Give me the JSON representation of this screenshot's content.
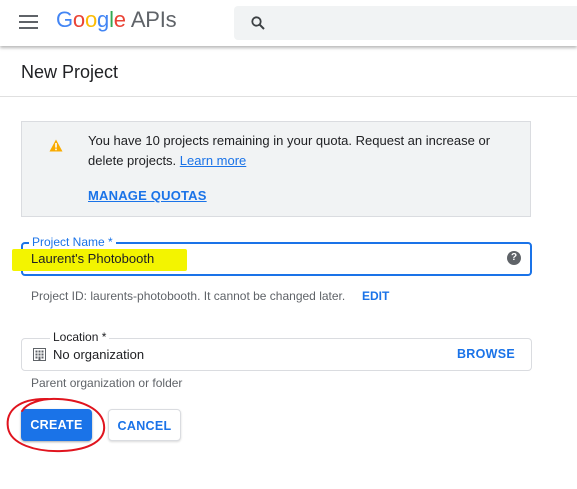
{
  "topbar": {
    "menu_icon": "hamburger-menu-icon",
    "logo_google": "Google",
    "logo_apis": "APIs",
    "search_icon": "search-icon",
    "search_placeholder": ""
  },
  "page": {
    "title": "New Project"
  },
  "notice": {
    "icon": "warning-icon",
    "message_prefix": "You have 10 projects remaining in your quota. Request an increase or delete projects.",
    "learn_more": "Learn more",
    "manage_quotas": "MANAGE QUOTAS"
  },
  "project_name": {
    "label": "Project Name",
    "required_mark": "*",
    "value": "Laurent's Photobooth",
    "help_icon": "help-icon",
    "highlight_color": "#f3f400"
  },
  "project_id": {
    "text": "Project ID: laurents-photobooth. It cannot be changed later.",
    "edit": "EDIT"
  },
  "location": {
    "label": "Location *",
    "icon": "building-icon",
    "value": "No organization",
    "browse": "BROWSE",
    "hint": "Parent organization or folder"
  },
  "actions": {
    "create": "CREATE",
    "cancel": "CANCEL"
  },
  "colors": {
    "accent": "#1a73e8",
    "warning": "#f9ab00",
    "annotation": "#e0141e"
  }
}
